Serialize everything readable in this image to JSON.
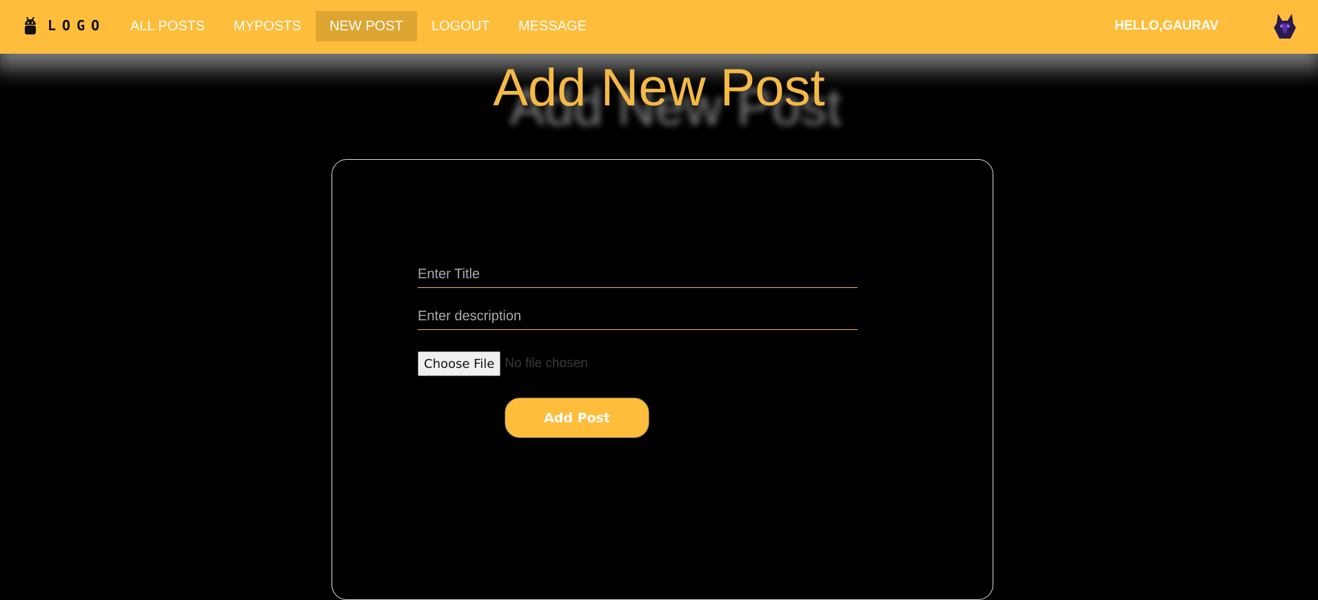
{
  "nav": {
    "logo_text": "LOGO",
    "items": [
      {
        "label": "ALL POSTS",
        "active": false
      },
      {
        "label": "MYPOSTS",
        "active": false
      },
      {
        "label": "NEW POST",
        "active": true
      },
      {
        "label": "LOGOUT",
        "active": false
      },
      {
        "label": "MESSAGE",
        "active": false
      }
    ],
    "greeting": "HELLO,GAURAV",
    "logo_icon": "android-icon",
    "avatar_icon": "wolf-avatar-icon"
  },
  "page": {
    "title": "Add New Post"
  },
  "form": {
    "title_placeholder": "Enter Title",
    "title_value": "",
    "description_placeholder": "Enter description",
    "description_value": "",
    "file_button_label": "Choose File",
    "file_status": "No file chosen",
    "submit_label": "Add Post"
  },
  "colors": {
    "accent": "#ffbd3c",
    "active_nav": "#dea532",
    "title": "#f5b945",
    "background": "#000000"
  }
}
